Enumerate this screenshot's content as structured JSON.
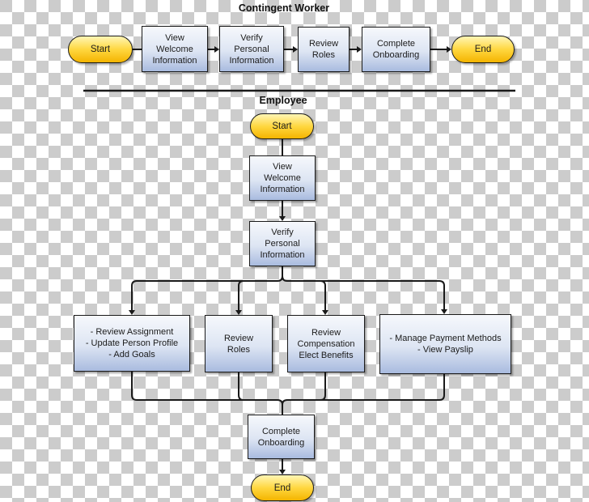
{
  "contingent_worker": {
    "title": "Contingent Worker",
    "start": "Start",
    "steps": [
      "View\nWelcome\nInformation",
      "Verify\nPersonal\nInformation",
      "Review\nRoles",
      "Complete\nOnboarding"
    ],
    "end": "End"
  },
  "employee": {
    "title": "Employee",
    "start": "Start",
    "steps": [
      "View\nWelcome\nInformation",
      "Verify\nPersonal\nInformation"
    ],
    "parallel": [
      "- Review Assignment\n- Update Person Profile\n- Add Goals",
      "Review\nRoles",
      "Review\nCompensation\nElect Benefits",
      "- Manage Payment Methods\n- View Payslip"
    ],
    "final_step": "Complete\nOnboarding",
    "end": "End"
  }
}
